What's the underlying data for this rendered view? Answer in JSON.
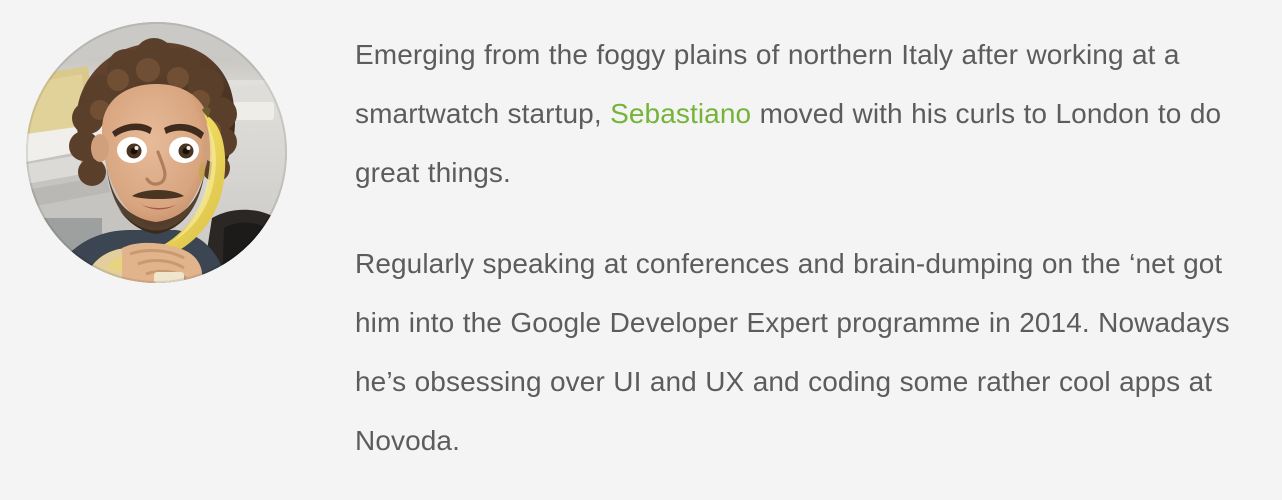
{
  "theme": {
    "background": "#f4f4f4",
    "text_color": "#5c5c5c",
    "link_color": "#76b339"
  },
  "avatar": {
    "alt": "Portrait photo of Sebastiano smiling while holding a banana to his ear like a phone",
    "shape": "circle",
    "icon": "avatar-photo"
  },
  "bio": {
    "paragraphs": [
      {
        "before_link": "Emerging from the foggy plains of northern Italy after working at a smartwatch startup, ",
        "link_text": "Sebastiano",
        "after_link": " moved with his curls to London to do great things."
      },
      {
        "text": "Regularly speaking at conferences and brain-dumping on the ‘net got him into the Google Developer Expert programme in 2014. Nowadays he’s obsessing over UI and UX and coding some rather cool apps at Novoda."
      }
    ]
  }
}
